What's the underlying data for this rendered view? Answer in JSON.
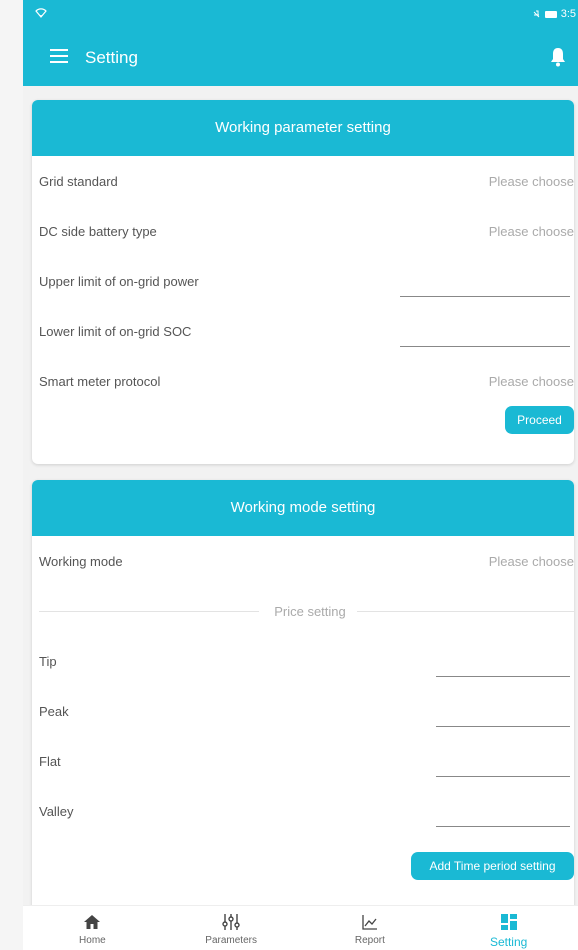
{
  "status_bar": {
    "time": "3:5"
  },
  "app_bar": {
    "title": "Setting"
  },
  "working_parameter": {
    "header": "Working parameter setting",
    "rows": [
      {
        "label": "Grid standard",
        "value": "Please choose"
      },
      {
        "label": "DC side battery type",
        "value": "Please choose"
      },
      {
        "label": "Upper limit of on-grid power",
        "value": ""
      },
      {
        "label": "Lower limit of on-grid SOC",
        "value": ""
      },
      {
        "label": "Smart meter protocol",
        "value": "Please choose"
      }
    ],
    "proceed_label": "Proceed"
  },
  "working_mode": {
    "header": "Working mode setting",
    "mode_label": "Working mode",
    "mode_value": "Please choose",
    "price_divider": "Price setting",
    "price_rows": [
      "Tip",
      "Peak",
      "Flat",
      "Valley"
    ],
    "add_time_label": "Add Time period setting"
  },
  "bottom_nav": [
    {
      "label": "Home",
      "icon": "home-icon",
      "active": false
    },
    {
      "label": "Parameters",
      "icon": "sliders-icon",
      "active": false
    },
    {
      "label": "Report",
      "icon": "chart-icon",
      "active": false
    },
    {
      "label": "Setting",
      "icon": "setting-icon",
      "active": true
    }
  ],
  "colors": {
    "accent": "#1ab9d4"
  }
}
